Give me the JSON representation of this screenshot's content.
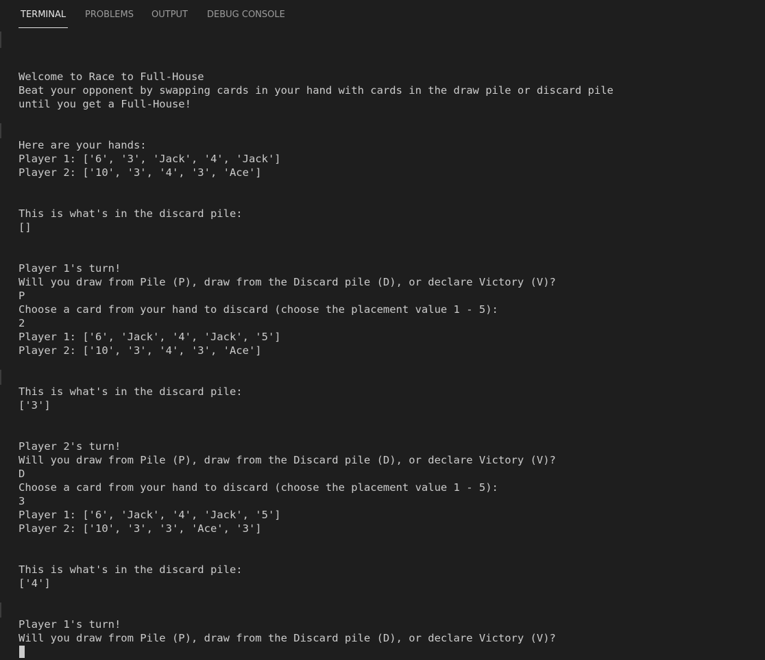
{
  "tabs": {
    "terminal": "TERMINAL",
    "problems": "PROBLEMS",
    "output": "OUTPUT",
    "debug_console": "DEBUG CONSOLE"
  },
  "terminal_lines": [
    "Welcome to Race to Full-House",
    "Beat your opponent by swapping cards in your hand with cards in the draw pile or discard pile",
    "until you get a Full-House!",
    "Here are your hands:",
    "Player 1: ['6', '3', 'Jack', '4', 'Jack']",
    "Player 2: ['10', '3', '4', '3', 'Ace']",
    "This is what's in the discard pile:",
    "[]",
    "Player 1's turn!",
    "Will you draw from Pile (P), draw from the Discard pile (D), or declare Victory (V)?",
    "P",
    "Choose a card from your hand to discard (choose the placement value 1 - 5):",
    "2",
    "Player 1: ['6', 'Jack', '4', 'Jack', '5']",
    "Player 2: ['10', '3', '4', '3', 'Ace']",
    "This is what's in the discard pile:",
    "['3']",
    "Player 2's turn!",
    "Will you draw from Pile (P), draw from the Discard pile (D), or declare Victory (V)?",
    "D",
    "Choose a card from your hand to discard (choose the placement value 1 - 5):",
    "3",
    "Player 1: ['6', 'Jack', '4', 'Jack', '5']",
    "Player 2: ['10', '3', '3', 'Ace', '3']",
    "This is what's in the discard pile:",
    "['4']",
    "Player 1's turn!",
    "Will you draw from Pile (P), draw from the Discard pile (D), or declare Victory (V)?"
  ],
  "colors": {
    "background": "#1e1e1e",
    "text": "#cccccc",
    "tab_inactive": "#9d9d9d",
    "tab_active": "#e7e7e7"
  }
}
